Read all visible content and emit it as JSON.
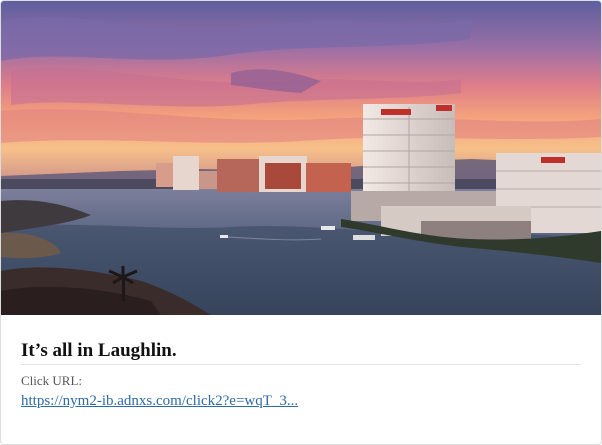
{
  "ad": {
    "headline": "It’s all in Laughlin.",
    "click_url_label": "Click URL:",
    "click_url_text": "https://nym2-ib.adnxs.com/click2?e=wqT_3..."
  },
  "colors": {
    "link": "#2e6aa6",
    "sky_top": "#6a6aa8",
    "sky_sunset": "#f08a78",
    "water": "#3e4f6a"
  }
}
